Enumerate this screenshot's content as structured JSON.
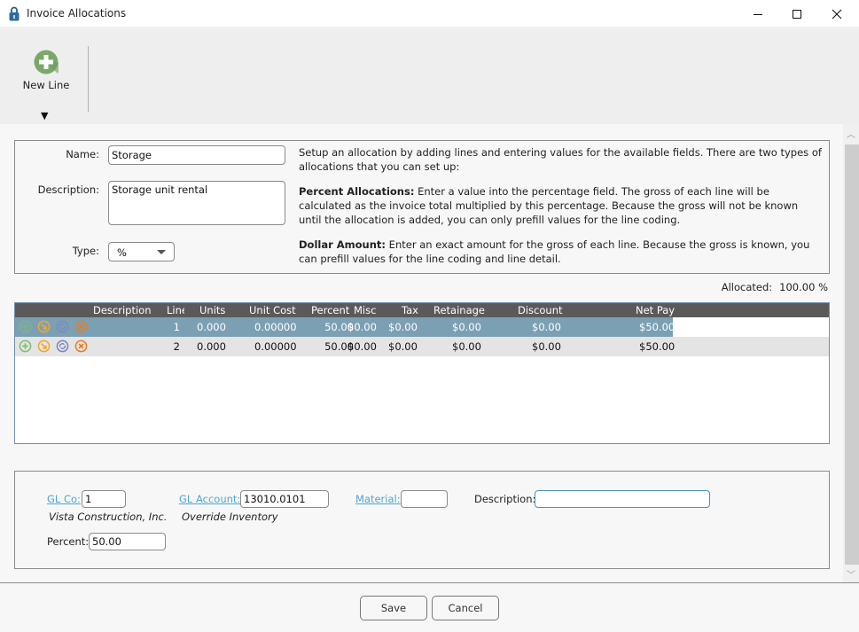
{
  "window": {
    "title": "Invoice Allocations",
    "icons": {
      "app": "lock-icon",
      "minimize": "minimize-icon",
      "maximize": "maximize-icon",
      "close": "close-icon"
    }
  },
  "toolbar": {
    "new_line_label": "New Line",
    "new_line_icon": "plus-circle-icon",
    "dropdown_glyph": "▼"
  },
  "header": {
    "name_label": "Name:",
    "name_value": "Storage",
    "description_label": "Description:",
    "description_value": "Storage unit rental",
    "type_label": "Type:",
    "type_value": "%",
    "help": {
      "intro": "Setup an allocation by adding lines and entering values for the available fields. There are two types of allocations that you can set up:",
      "percent_title": "Percent Allocations:",
      "percent_text": " Enter a value into the percentage field. The gross of each line will be calculated as the invoice total multiplied by this percentage. Because the gross will not be known until the allocation is added, you can only prefill values for the line coding.",
      "dollar_title": "Dollar Amount:",
      "dollar_text": " Enter an exact amount for the gross of each line. Because the gross is known, you can prefill values for the line coding and line detail."
    }
  },
  "allocated": {
    "label": "Allocated:",
    "value": "100.00 %"
  },
  "grid": {
    "columns": [
      "Description",
      "Line",
      "Units",
      "Unit Cost",
      "Percent",
      "Misc",
      "Tax",
      "Retainage",
      "Discount",
      "Net Pay"
    ],
    "row_icons": [
      "add-icon",
      "edit-icon",
      "refresh-icon",
      "delete-icon"
    ],
    "rows": [
      {
        "description": "",
        "line": "1",
        "units": "0.000",
        "unit_cost": "0.00000",
        "percent": "50.00",
        "misc": "$0.00",
        "tax": "$0.00",
        "retainage": "$0.00",
        "discount": "$0.00",
        "net_pay": "$50.00",
        "selected": true
      },
      {
        "description": "",
        "line": "2",
        "units": "0.000",
        "unit_cost": "0.00000",
        "percent": "50.00",
        "misc": "$0.00",
        "tax": "$0.00",
        "retainage": "$0.00",
        "discount": "$0.00",
        "net_pay": "$50.00",
        "selected": false
      }
    ]
  },
  "detail": {
    "gl_co_label": "GL Co:",
    "gl_co_value": "1",
    "gl_co_desc": "Vista Construction, Inc.",
    "gl_account_label": "GL Account:",
    "gl_account_value": "13010.0101",
    "gl_account_desc": "Override Inventory",
    "material_label": "Material:",
    "material_value": "",
    "description_label": "Description:",
    "description_value": "",
    "percent_label": "Percent:",
    "percent_value": "50.00"
  },
  "footer": {
    "save_label": "Save",
    "cancel_label": "Cancel"
  },
  "colors": {
    "accent_link": "#4aa8d8",
    "grid_header": "#5a5a5a",
    "selected_row": "#7ba0b4",
    "add_green": "#7cbf72",
    "edit_orange": "#f0a92a",
    "refresh_blue": "#7a83c9",
    "delete_orange": "#f07a1a"
  }
}
